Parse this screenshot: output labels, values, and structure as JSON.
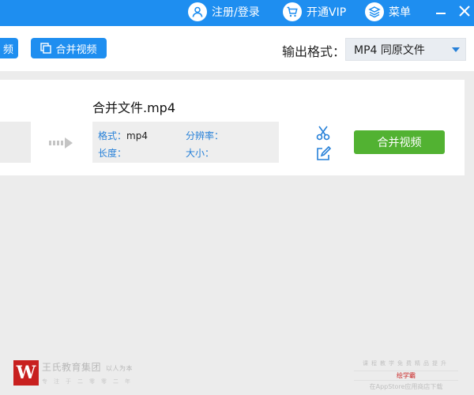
{
  "header": {
    "register_login": "注册/登录",
    "vip": "开通VIP",
    "menu": "菜单"
  },
  "toolbar": {
    "left_button_label": "频",
    "merge_button_label": "合并视频",
    "output_format_label": "输出格式：",
    "output_format_value": "MP4  同原文件"
  },
  "task": {
    "file_name": "合并文件.mp4",
    "format_key": "格式：",
    "format_value": "mp4",
    "resolution_key": "分辨率：",
    "resolution_value": "",
    "length_key": "长度：",
    "length_value": "",
    "size_key": "大小：",
    "size_value": "",
    "action_label": "合并视频"
  },
  "footer": {
    "brand_left_logo": "W",
    "brand_left_name": "王氏教育集团",
    "brand_left_tag": "以人为本",
    "brand_left_slogan": "专注于二零零二年",
    "brand_right_line1": "课程教学免费精品提升",
    "brand_right_name": "绘学霸",
    "brand_right_line3": "在AppStore应用商店下载"
  },
  "colors": {
    "primary_blue": "#1e8ef0",
    "merge_green": "#52b232",
    "brand_red": "#c8201f"
  }
}
